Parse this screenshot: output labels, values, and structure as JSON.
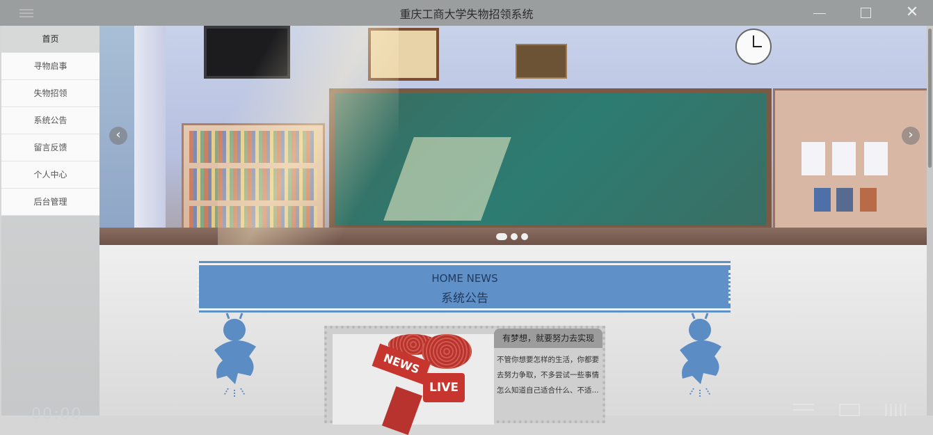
{
  "window": {
    "title": "重庆工商大学失物招领系统",
    "icons": [
      "menu-icon",
      "minimize-icon",
      "maximize-icon",
      "close-icon"
    ]
  },
  "sidebar": {
    "items": [
      {
        "label": "首页",
        "active": true
      },
      {
        "label": "寻物启事"
      },
      {
        "label": "失物招领"
      },
      {
        "label": "系统公告"
      },
      {
        "label": "留言反馈"
      },
      {
        "label": "个人中心"
      },
      {
        "label": "后台管理"
      }
    ],
    "clock_text": "00:00"
  },
  "carousel": {
    "prev_label": "‹",
    "next_label": "›",
    "slide_count": 3,
    "active_slide": 1
  },
  "news_section": {
    "title_en": "HOME NEWS",
    "title_cn": "系统公告",
    "card": {
      "image_labels": {
        "news": "NEWS",
        "live": "LIVE"
      },
      "title": "有梦想，就要努力去实现",
      "body": "不管你想要怎样的生活，你都要去努力争取，不多尝试一些事情怎么知道自己适合什么、不适..."
    }
  },
  "colors": {
    "titlebar": "#9a9e9f",
    "accent_blue": "#6090c8",
    "news_red": "#c6362f"
  }
}
